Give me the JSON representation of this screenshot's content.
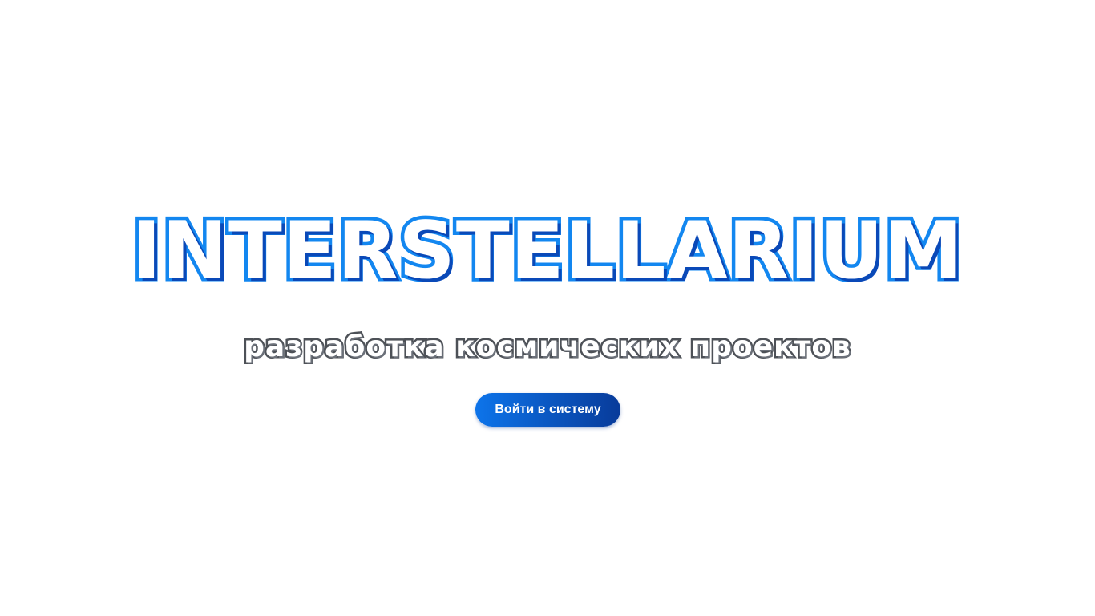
{
  "hero": {
    "title": "INTERSTELLARIUM",
    "tagline": "разработка космических проектов",
    "login_button_label": "Войти в систему"
  },
  "colors": {
    "title_gradient_start": "#1387f0",
    "title_gradient_end": "#0a49b8",
    "tagline_outline": "#4d5157",
    "button_gradient_start": "#0d74ea",
    "button_gradient_end": "#083b9a",
    "background": "#ffffff"
  }
}
